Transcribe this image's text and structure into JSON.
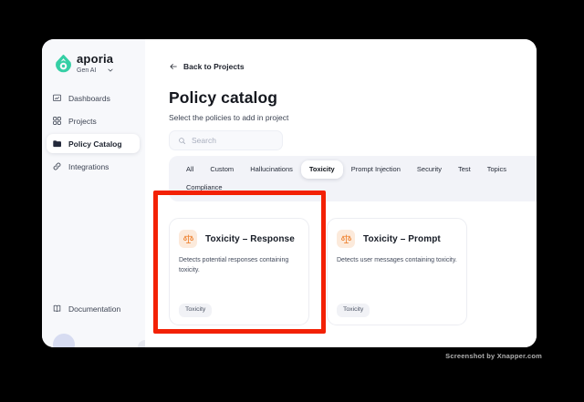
{
  "brand": {
    "name": "aporia",
    "workspace": "Gen AI"
  },
  "sidebar": {
    "items": [
      {
        "label": "Dashboards",
        "icon": "dashboards-icon",
        "active": false
      },
      {
        "label": "Projects",
        "icon": "projects-icon",
        "active": false
      },
      {
        "label": "Policy Catalog",
        "icon": "folder-icon",
        "active": true
      },
      {
        "label": "Integrations",
        "icon": "integrations-icon",
        "active": false
      }
    ],
    "documentation": {
      "label": "Documentation",
      "icon": "book-icon"
    }
  },
  "header": {
    "back_label": "Back to Projects",
    "title": "Policy catalog",
    "subtitle": "Select the policies to add in project"
  },
  "search": {
    "placeholder": "Search"
  },
  "tabs": {
    "items": [
      "All",
      "Custom",
      "Hallucinations",
      "Toxicity",
      "Prompt Injection",
      "Security",
      "Test",
      "Topics",
      "Compliance"
    ],
    "active": "Toxicity"
  },
  "cards": [
    {
      "title": "Toxicity – Response",
      "description": "Detects potential responses containing toxicity.",
      "tag": "Toxicity",
      "icon": "scales-icon",
      "highlighted": true
    },
    {
      "title": "Toxicity – Prompt",
      "description": "Detects user messages containing toxicity.",
      "tag": "Toxicity",
      "icon": "scales-icon",
      "highlighted": false
    }
  ],
  "watermark": {
    "text": "Screenshot by Xnapper.com"
  },
  "colors": {
    "brand_teal": "#35CFA5",
    "highlight_red": "#F32105",
    "policy_icon_orange": "#EE8434",
    "policy_icon_bg": "#FCEADB"
  }
}
